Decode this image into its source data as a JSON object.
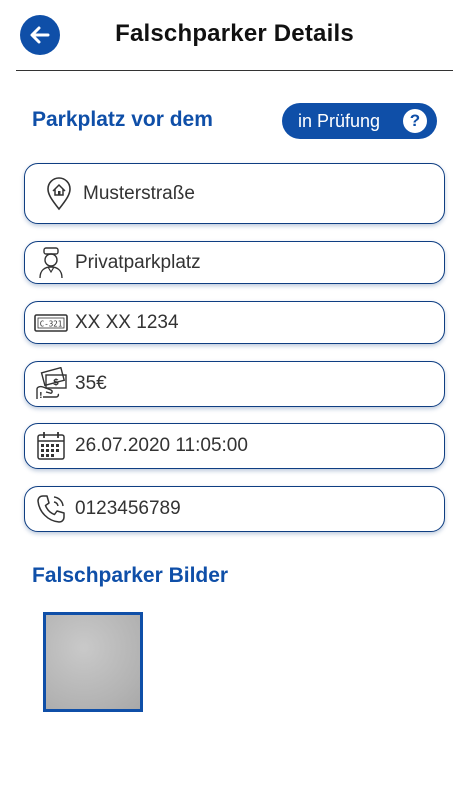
{
  "header": {
    "title": "Falschparker Details",
    "back_icon": "arrow-left-icon"
  },
  "parking": {
    "section_title": "Parkplatz vor dem",
    "status_label": "in Prüfung",
    "help_glyph": "?"
  },
  "fields": [
    {
      "icon": "house-pin-icon",
      "value": "Musterstraße"
    },
    {
      "icon": "parking-attendant-icon",
      "value": "Privatparkplatz"
    },
    {
      "icon": "license-plate-icon",
      "value": "XX XX 1234"
    },
    {
      "icon": "money-icon",
      "value": "35€"
    },
    {
      "icon": "calendar-icon",
      "value": "26.07.2020 11:05:00"
    },
    {
      "icon": "phone-icon",
      "value": "0123456789"
    }
  ],
  "images": {
    "section_title": "Falschparker Bilder"
  },
  "colors": {
    "primary": "#0f4fa8",
    "border": "#0f3e82"
  }
}
